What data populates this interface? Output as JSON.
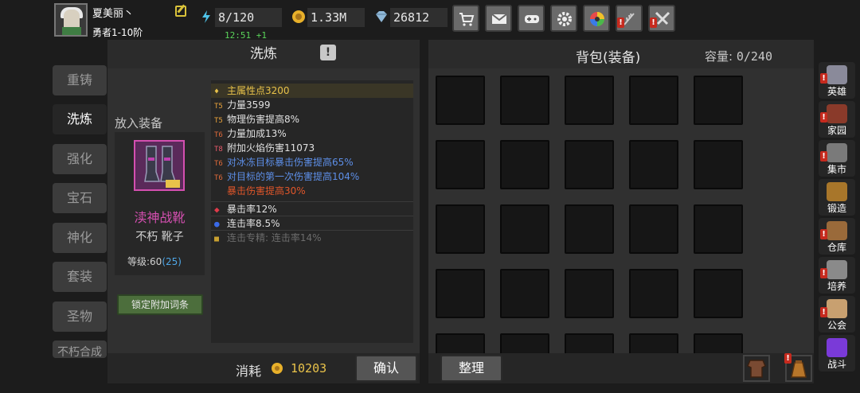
{
  "player": {
    "name": "夏美丽丶",
    "rank": "勇者1-10阶"
  },
  "resources": {
    "stamina": "8/120",
    "timer": "12:51 +1",
    "gold": "1.33M",
    "gems": "26812"
  },
  "top_icons": [
    "cart-icon",
    "mail-icon",
    "gamepad-icon",
    "gear-icon",
    "color-wheel-icon",
    "feather-icon",
    "swords-icon"
  ],
  "left_tabs": [
    "重铸",
    "洗炼",
    "强化",
    "宝石",
    "神化",
    "套装",
    "圣物",
    "不朽合成"
  ],
  "refine": {
    "title": "洗炼",
    "put_label": "放入装备",
    "item_name": "渎神战靴",
    "item_type": "不朽  靴子",
    "level_label": "等级:",
    "level": "60",
    "level_bonus": "(25)",
    "lock_button": "锁定附加词条",
    "attributes": [
      {
        "tier": "",
        "text": "主属性点3200",
        "color": "#e8c24a"
      },
      {
        "tier": "T5",
        "text": "力量3599",
        "color": "#e0e0e0"
      },
      {
        "tier": "T5",
        "text": "物理伤害提高8%",
        "color": "#e0e0e0"
      },
      {
        "tier": "T6",
        "text": "力量加成13%",
        "color": "#e0e0e0"
      },
      {
        "tier": "T8",
        "text": "附加火焰伤害11073",
        "color": "#e0e0e0"
      },
      {
        "tier": "T6",
        "text": "对冰冻目标暴击伤害提高65%",
        "color": "#5d8fe8"
      },
      {
        "tier": "T6",
        "text": "对目标的第一次伤害提高104%",
        "color": "#5d8fe8"
      },
      {
        "tier": "",
        "text": "暴击伤害提高30%",
        "color": "#e0562a"
      },
      {
        "tier": "",
        "text": "暴击率12%",
        "color": "#e0e0e0"
      },
      {
        "tier": "",
        "text": "连击率8.5%",
        "color": "#e0e0e0"
      },
      {
        "tier": "",
        "text": "连击专精:  连击率14%",
        "color": "#6c6c6c"
      }
    ],
    "cost_label": "消耗",
    "cost_value": "10203",
    "confirm_button": "确认"
  },
  "bag": {
    "title": "背包(装备)",
    "capacity_label": "容量:",
    "capacity": "0/240",
    "sort_button": "整理"
  },
  "right_menu": [
    "英雄",
    "家园",
    "集市",
    "锻造",
    "仓库",
    "培养",
    "公会",
    "战斗"
  ],
  "colors": {
    "accent": "#d44fb0",
    "blue": "#5d8fe8",
    "orange": "#e0562a",
    "gold": "#e8c24a",
    "green_btn": "#4c6e3c"
  }
}
